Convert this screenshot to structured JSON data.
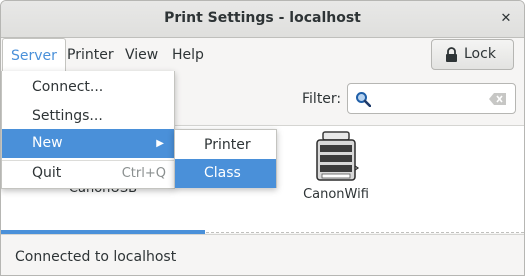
{
  "window": {
    "title": "Print Settings - localhost",
    "close_glyph": "✕"
  },
  "menubar": {
    "items": [
      {
        "label": "Server"
      },
      {
        "label": "Printer"
      },
      {
        "label": "View"
      },
      {
        "label": "Help"
      }
    ],
    "lock_label": "Lock"
  },
  "filter": {
    "label": "Filter:",
    "value": "",
    "placeholder": ""
  },
  "printers": [
    {
      "name": "CanonUSB"
    },
    {
      "name": "CanonWifi"
    }
  ],
  "status": {
    "text": "Connected to localhost"
  },
  "server_menu": {
    "items": [
      {
        "label": "Connect..."
      },
      {
        "label": "Settings..."
      },
      {
        "label": "New",
        "arrow": "▶"
      },
      {
        "label": "Quit",
        "accel": "Ctrl+Q"
      }
    ]
  },
  "new_submenu": {
    "items": [
      {
        "label": "Printer"
      },
      {
        "label": "Class"
      }
    ]
  },
  "colors": {
    "accent": "#4a90d9",
    "window_bg": "#f6f5f4"
  }
}
